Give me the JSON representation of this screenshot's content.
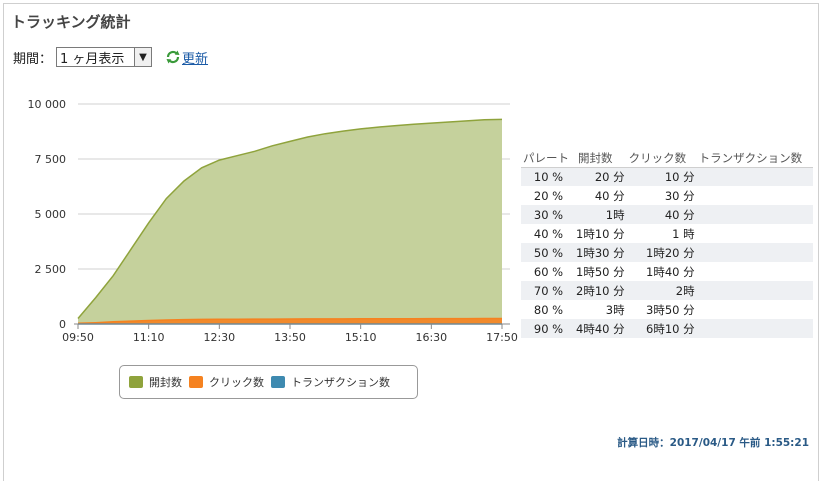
{
  "page": {
    "title": "トラッキング統計",
    "period_label": "期間：",
    "period_value": "1 ヶ月表示",
    "refresh_label": "更新",
    "calc_date": "計算日時：2017/04/17 午前 1:55:21"
  },
  "colors": {
    "opens": "#8fa33c",
    "opens_fill": "#c5d19c",
    "clicks": "#f58220",
    "transactions": "#3e8ab0"
  },
  "legend": [
    {
      "name": "開封数",
      "color": "#8fa33c"
    },
    {
      "name": "クリック数",
      "color": "#f58220"
    },
    {
      "name": "トランザクション数",
      "color": "#3e8ab0"
    }
  ],
  "table": {
    "headers": [
      "パレート",
      "開封数",
      "クリック数",
      "トランザクション数"
    ],
    "rows": [
      [
        "10 %",
        "20 分",
        "10 分",
        ""
      ],
      [
        "20 %",
        "40 分",
        "30 分",
        ""
      ],
      [
        "30 %",
        "1時",
        "40 分",
        ""
      ],
      [
        "40 %",
        "1時10 分",
        "1 時",
        ""
      ],
      [
        "50 %",
        "1時30 分",
        "1時20 分",
        ""
      ],
      [
        "60 %",
        "1時50 分",
        "1時40 分",
        ""
      ],
      [
        "70 %",
        "2時10 分",
        "2時",
        ""
      ],
      [
        "80 %",
        "3時",
        "3時50 分",
        ""
      ],
      [
        "90 %",
        "4時40 分",
        "6時10 分",
        ""
      ]
    ]
  },
  "chart_data": {
    "type": "area",
    "x": [
      "09:50",
      "10:10",
      "10:30",
      "10:50",
      "11:10",
      "11:30",
      "11:50",
      "12:10",
      "12:30",
      "12:50",
      "13:10",
      "13:30",
      "13:50",
      "14:10",
      "14:30",
      "14:50",
      "15:10",
      "15:30",
      "15:50",
      "16:10",
      "16:30",
      "16:50",
      "17:10",
      "17:30",
      "17:50"
    ],
    "x_ticks": [
      "09:50",
      "11:10",
      "12:30",
      "13:50",
      "15:10",
      "16:30",
      "17:50"
    ],
    "y_ticks": [
      "0",
      "2 500",
      "5 000",
      "7 500",
      "10 000"
    ],
    "ylim": [
      0,
      10000
    ],
    "series": [
      {
        "name": "開封数",
        "values": [
          250,
          1200,
          2200,
          3400,
          4600,
          5700,
          6500,
          7100,
          7450,
          7650,
          7850,
          8100,
          8300,
          8500,
          8650,
          8770,
          8870,
          8950,
          9020,
          9080,
          9130,
          9180,
          9230,
          9280,
          9300
        ]
      },
      {
        "name": "クリック数",
        "values": [
          30,
          60,
          100,
          130,
          160,
          180,
          200,
          210,
          215,
          220,
          222,
          225,
          228,
          230,
          232,
          234,
          236,
          238,
          240,
          242,
          244,
          245,
          246,
          248,
          250
        ]
      },
      {
        "name": "トランザクション数",
        "values": [
          0,
          0,
          0,
          0,
          0,
          0,
          0,
          0,
          0,
          0,
          0,
          0,
          0,
          0,
          0,
          0,
          0,
          0,
          0,
          0,
          0,
          0,
          0,
          0,
          0
        ]
      }
    ],
    "legend_position": "bottom",
    "grid": true
  }
}
